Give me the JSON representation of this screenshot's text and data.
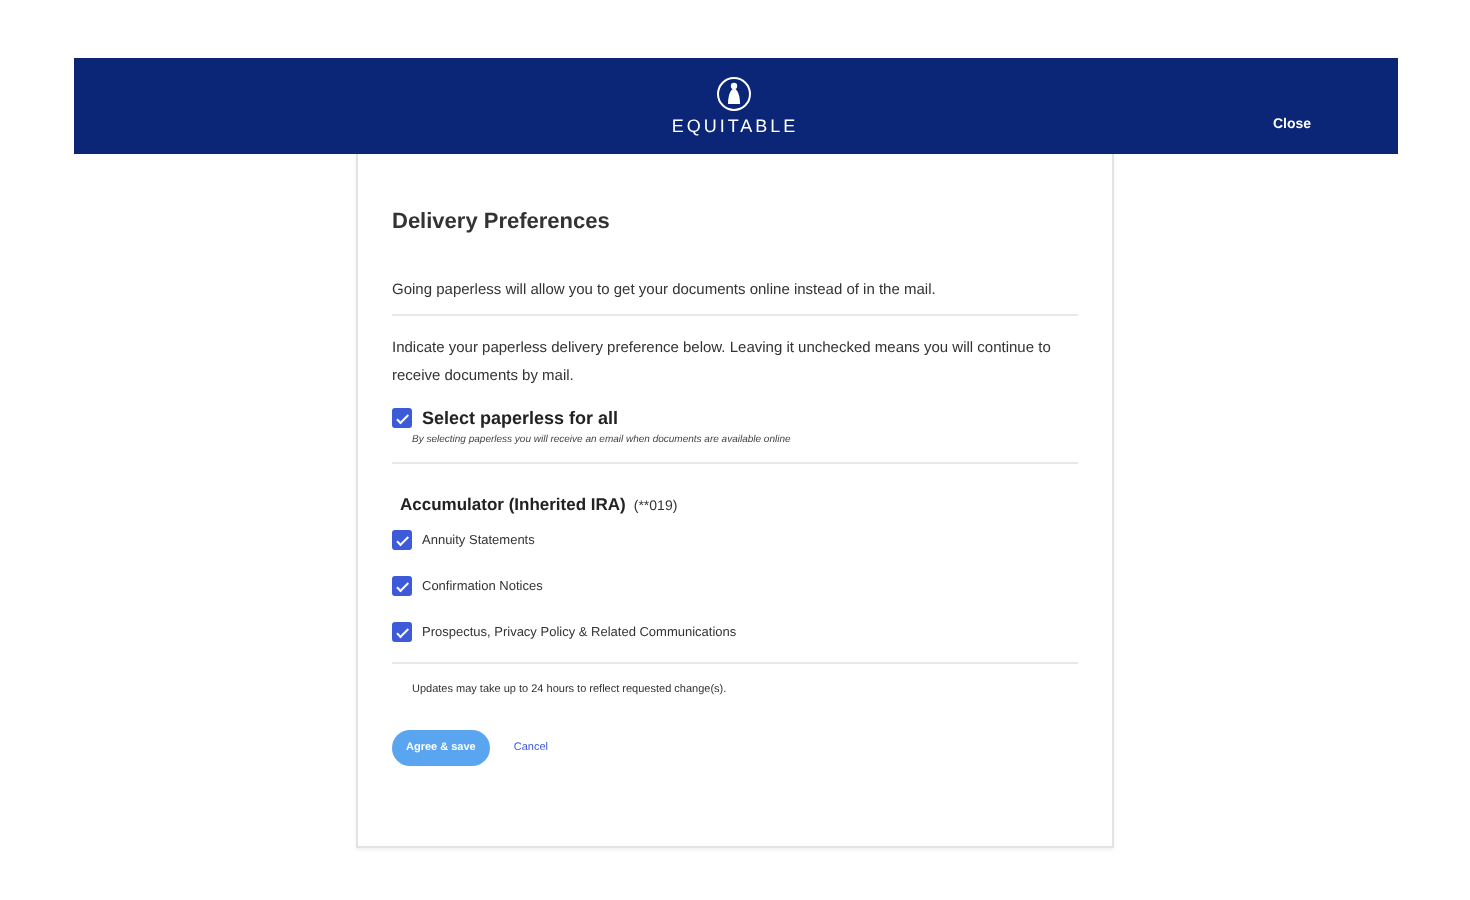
{
  "header": {
    "brand": "EQUITABLE",
    "close": "Close"
  },
  "card": {
    "title": "Delivery Preferences",
    "intro": "Going paperless will allow you to get your documents online instead of in the mail.",
    "instructions": "Indicate your paperless delivery preference below. Leaving it unchecked means you will continue to receive documents by mail.",
    "select_all": {
      "label": "Select paperless for all",
      "checked": true,
      "note": "By selecting paperless you will receive an email when documents are available online"
    },
    "account": {
      "name": "Accumulator (Inherited IRA)",
      "number": "(**019)"
    },
    "options": [
      {
        "label": "Annuity Statements",
        "checked": true
      },
      {
        "label": "Confirmation Notices",
        "checked": true
      },
      {
        "label": "Prospectus, Privacy Policy & Related Communications",
        "checked": true
      }
    ],
    "notice": "Updates may take up to 24 hours to reflect requested change(s).",
    "buttons": {
      "primary": "Agree & save",
      "secondary": "Cancel"
    }
  }
}
